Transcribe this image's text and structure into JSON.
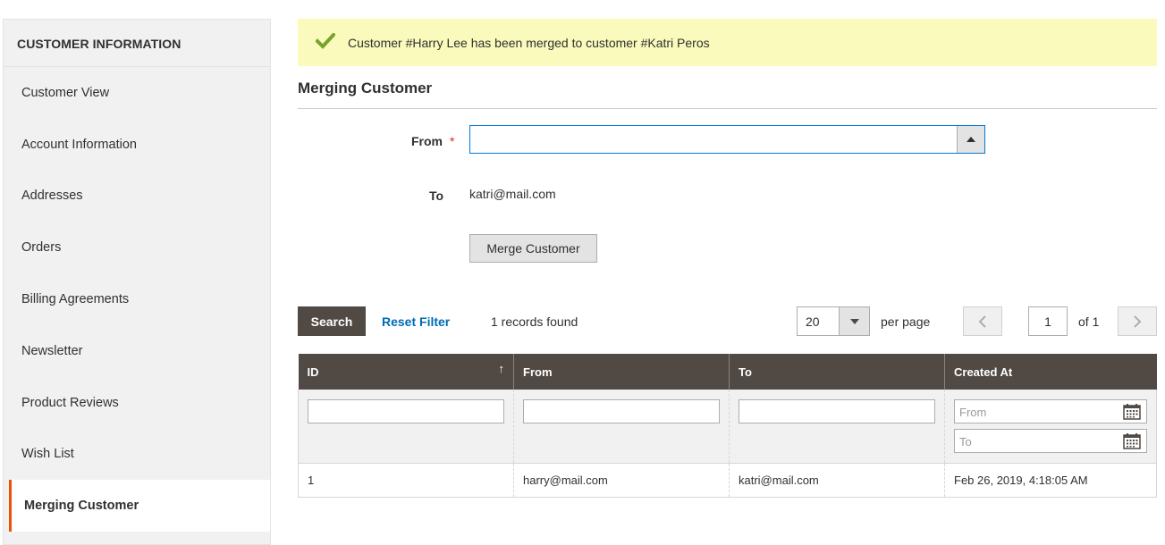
{
  "sidebar": {
    "title": "CUSTOMER INFORMATION",
    "items": [
      {
        "label": "Customer View"
      },
      {
        "label": "Account Information"
      },
      {
        "label": "Addresses"
      },
      {
        "label": "Orders"
      },
      {
        "label": "Billing Agreements"
      },
      {
        "label": "Newsletter"
      },
      {
        "label": "Product Reviews"
      },
      {
        "label": "Wish List"
      },
      {
        "label": "Merging Customer",
        "active": true
      }
    ]
  },
  "message": {
    "type": "success",
    "text": "Customer #Harry Lee has been merged to customer #Katri Peros"
  },
  "section": {
    "title": "Merging Customer"
  },
  "form": {
    "from_label": "From",
    "required_mark": "*",
    "from_value": "",
    "to_label": "To",
    "to_value": "katri@mail.com",
    "merge_button": "Merge Customer"
  },
  "toolbar": {
    "search_label": "Search",
    "reset_label": "Reset Filter",
    "records_found": "1 records found",
    "per_page_value": "20",
    "per_page_label": "per page",
    "current_page": "1",
    "of_total": "of 1"
  },
  "grid": {
    "columns": [
      "ID",
      "From",
      "To",
      "Created At"
    ],
    "sort_indicator": "↑",
    "filters": {
      "date_from_placeholder": "From",
      "date_to_placeholder": "To"
    },
    "rows": [
      {
        "id": "1",
        "from": "harry@mail.com",
        "to": "katri@mail.com",
        "created_at": "Feb 26, 2019, 4:18:05 AM"
      }
    ]
  },
  "colors": {
    "accent": "#eb5202",
    "header_bg": "#514943",
    "link": "#006bb4",
    "success_bg": "#fafabc",
    "success_icon": "#79a22e"
  }
}
